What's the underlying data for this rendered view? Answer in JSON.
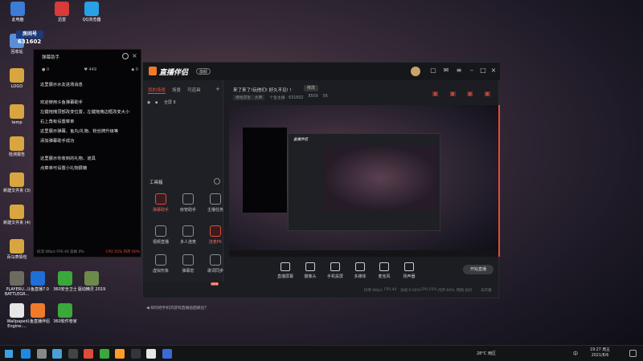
{
  "desktop": {
    "icons": [
      {
        "label": "此电脑",
        "color": "#3c7bd6"
      },
      {
        "label": "迅雷",
        "color": "#d93a3a"
      },
      {
        "label": "QQ浏览器",
        "color": "#2aa0e6"
      },
      {
        "label": "回收站",
        "color": "#5a8fd8"
      },
      {
        "label": "LOGO",
        "color": "#d8a640"
      },
      {
        "label": "temp",
        "color": "#d8a640"
      },
      {
        "label": "检测报告",
        "color": "#d8a640"
      },
      {
        "label": "新建文件夹 (3)",
        "color": "#d8a640"
      },
      {
        "label": "新建文件夹 (4)",
        "color": "#d8a640"
      },
      {
        "label": "百马表情包",
        "color": "#d8a640"
      },
      {
        "label": "PLAYERU... BATTLEGR...",
        "color": "#6d6a60"
      },
      {
        "label": "斗鱼直播7.0",
        "color": "#1e6fd6"
      },
      {
        "label": "360安全卫士",
        "color": "#3aa83a"
      },
      {
        "label": "驱动精灵 2019",
        "color": "#6d8a4a"
      },
      {
        "label": "Wallpaper Engine:...",
        "color": "#e6e6e6"
      },
      {
        "label": "斗鱼直播伴侣",
        "color": "#f07a2a"
      },
      {
        "label": "360软件管家",
        "color": "#3aa83a"
      }
    ],
    "room_badge": "房间号",
    "room_number": "631602"
  },
  "danmu_panel": {
    "title": "弹幕助手",
    "stats": [
      "0",
      "449",
      "0"
    ],
    "lines": [
      "这里展示水友进场消息",
      "",
      "欢迎使用斗鱼弹幕助手",
      "左键拖拽顶部改变位置，左键拖拽边框改变大小",
      "右上角有设置菜单",
      "这里展示弹幕、鱼丸/礼物、粉丝牌升级等",
      "添加弹幕助手成功",
      "",
      "这里展示你收到的礼物、道具",
      "点菜单可设置小礼物屏蔽"
    ],
    "footer_left": "码流 0Kb/s  FPS 40  丢帧 0%",
    "footer_right": "CPU 25%  内存 60%"
  },
  "app": {
    "logo_text": "直播伴侣",
    "version_badge": "旗舰",
    "left_tabs": [
      "我的场景",
      "场景",
      "可道具"
    ],
    "scene_items": [
      "全屏 8"
    ],
    "stream_title": "来了来了!玩他们! 好久不见! !",
    "edit_label": "修改",
    "tags": [
      "绝地求生 · 大神",
      "个鱼主播 · 631602",
      "8509",
      "56"
    ],
    "tools_title": "工具箱",
    "tools": [
      {
        "label": "弹幕助手",
        "active": true
      },
      {
        "label": "房管助手",
        "active": false
      },
      {
        "label": "主播任务",
        "active": false
      },
      {
        "label": "视频直播",
        "active": false
      },
      {
        "label": "多人连麦",
        "active": false
      },
      {
        "label": "连麦PK",
        "active": true
      },
      {
        "label": "虚拟形象",
        "active": false
      },
      {
        "label": "弹幕宏",
        "active": false
      },
      {
        "label": "歌词同步",
        "active": false
      }
    ],
    "notice": "如何把手机的游戏直播画面输出?",
    "bottom_buttons": [
      "直播屏幕",
      "摄像头",
      "手机投屏",
      "多媒体",
      "麦克风",
      "扬声器"
    ],
    "start_button": "开始直播",
    "status_bar": [
      "码率:0Kb/s",
      "FPS:40",
      "丢帧:0.00%",
      "CPU:25%",
      "内存:60%",
      "网络:良好",
      "未开播"
    ],
    "new_badge": "NEW"
  },
  "preview": {
    "inner_logo": "直播伴侣"
  },
  "taskbar": {
    "weather": "28°C 雨区",
    "ime": "中",
    "time": "19:27 周五",
    "date": "2021/8/6",
    "icon_colors": [
      "#1e88e5",
      "#888888",
      "#4aa0d8",
      "#444444",
      "#e24a3a",
      "#3aa83a",
      "#ff9d2a",
      "#33373d",
      "#e6e6e6",
      "#3a6ad8"
    ]
  }
}
